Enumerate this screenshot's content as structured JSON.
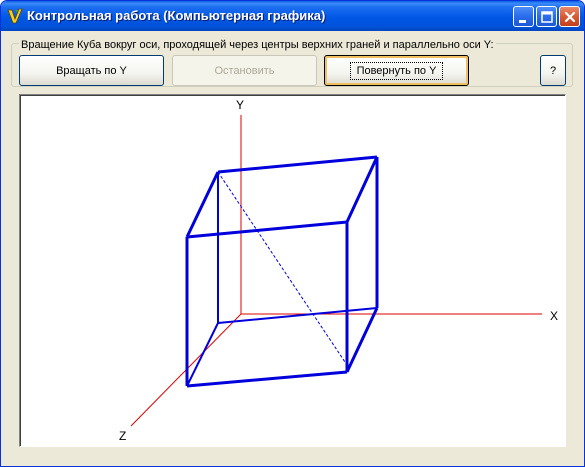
{
  "window": {
    "title": "Контрольная работа (Компьютерная графика)"
  },
  "titlebar_buttons": {
    "minimize_icon": "minimize-icon",
    "maximize_icon": "maximize-icon",
    "close_icon": "close-icon"
  },
  "controls": {
    "group_label": "Вращение Куба вокруг оси, проходящей через центры верхних граней и параллельно оси Y:",
    "rotate_label": "Вращать по Y",
    "stop_label": "Остановить",
    "turn_label": "Повернуть по Y",
    "help_label": "?"
  },
  "viewport": {
    "axis_x_label": "X",
    "axis_y_label": "Y",
    "axis_z_label": "Z",
    "colors": {
      "axes": "#dd0000",
      "cube": "#0000dd"
    }
  }
}
